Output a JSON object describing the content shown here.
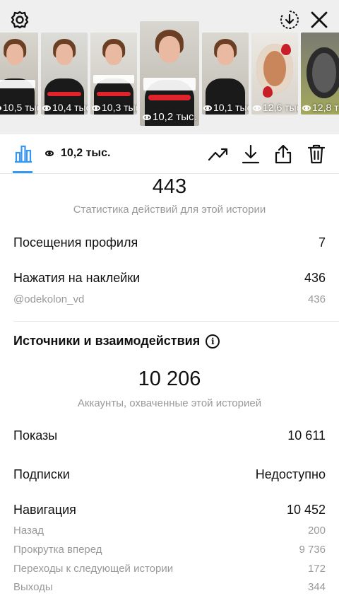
{
  "stories": [
    {
      "views": "10,5 тыс",
      "type": "person"
    },
    {
      "views": "10,4 тыс",
      "type": "person"
    },
    {
      "views": "10,3 тыс",
      "type": "person"
    },
    {
      "views": "10,2 тыс.",
      "type": "person",
      "active": true
    },
    {
      "views": "10,1 тыс",
      "type": "person"
    },
    {
      "views": "12,6 тыс",
      "type": "food"
    },
    {
      "views": "12,8 т",
      "type": "pan"
    }
  ],
  "toolbar": {
    "views": "10,2 тыс.",
    "icons": [
      "bar-chart-icon",
      "eye-icon",
      "trend-icon",
      "download-icon",
      "share-icon",
      "trash-icon"
    ]
  },
  "actions": {
    "total": "443",
    "caption": "Статистика действий для этой истории",
    "rows": [
      {
        "label": "Посещения профиля",
        "value": "7"
      },
      {
        "label": "Нажатия на наклейки",
        "value": "436"
      }
    ],
    "sticker": {
      "label": "@odekolon_vd",
      "value": "436"
    }
  },
  "sources": {
    "title": "Источники и взаимодействия",
    "reach": "10 206",
    "reach_caption": "Аккаунты, охваченные этой историей",
    "impressions": {
      "label": "Показы",
      "value": "10 611"
    },
    "follows": {
      "label": "Подписки",
      "value": "Недоступно"
    },
    "navigation": {
      "label": "Навигация",
      "value": "10 452"
    },
    "nav_items": [
      {
        "label": "Назад",
        "value": "200"
      },
      {
        "label": "Прокрутка вперед",
        "value": "9 736"
      },
      {
        "label": "Переходы к следующей истории",
        "value": "172"
      },
      {
        "label": "Выходы",
        "value": "344"
      }
    ]
  },
  "colors": {
    "accent": "#3897f0",
    "muted": "#999999",
    "strip_bg": "#efefef"
  }
}
